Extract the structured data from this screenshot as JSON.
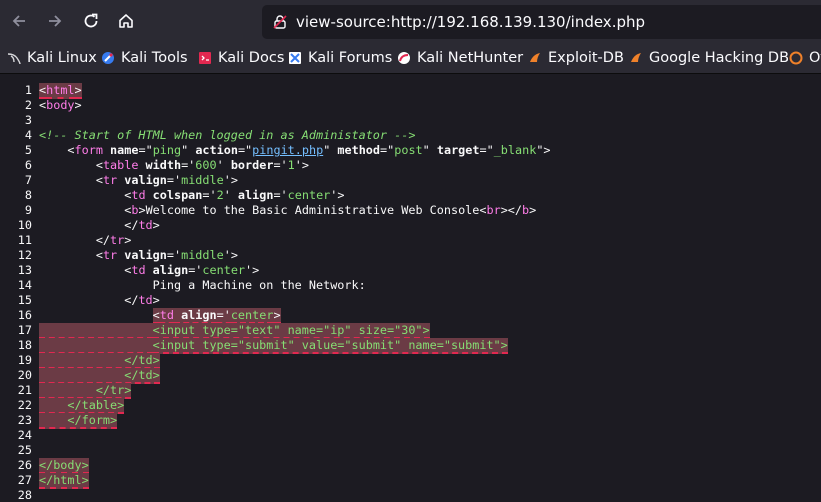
{
  "browser": {
    "url": "view-source:http://192.168.139.130/index.php"
  },
  "bookmarks": [
    {
      "label": "Kali Linux",
      "icon": "kali-dragon-icon"
    },
    {
      "label": "Kali Tools",
      "icon": "kali-tools-icon"
    },
    {
      "label": "Kali Docs",
      "icon": "kali-docs-icon"
    },
    {
      "label": "Kali Forums",
      "icon": "kali-forums-icon"
    },
    {
      "label": "Kali NetHunter",
      "icon": "kali-nethunter-icon"
    },
    {
      "label": "Exploit-DB",
      "icon": "exploit-db-icon"
    },
    {
      "label": "Google Hacking DB",
      "icon": "ghdb-icon"
    },
    {
      "label": "Of",
      "icon": "offsec-icon"
    }
  ],
  "colors": {
    "background": "#1c1b22",
    "toolbar": "#2b2a33",
    "tag_name": "#ff7de9",
    "attr_value": "#86de74",
    "link": "#75bfff",
    "error_highlight": "#6b3b45"
  },
  "source_lines": [
    {
      "n": "1",
      "segs": [
        {
          "t": "<",
          "c": "tag"
        },
        {
          "t": "html",
          "c": "tn"
        },
        {
          "t": ">",
          "c": "tag"
        }
      ],
      "err": true
    },
    {
      "n": "2",
      "segs": [
        {
          "t": "<",
          "c": "tag"
        },
        {
          "t": "body",
          "c": "tn"
        },
        {
          "t": ">",
          "c": "tag"
        }
      ]
    },
    {
      "n": "3",
      "segs": []
    },
    {
      "n": "4",
      "segs": [
        {
          "t": "<!-- Start of HTML when logged in as Administator -->",
          "c": "cm"
        }
      ]
    },
    {
      "n": "5",
      "segs": [
        {
          "t": "    ",
          "c": "tag"
        },
        {
          "t": "<",
          "c": "tag"
        },
        {
          "t": "form",
          "c": "tn"
        },
        {
          "t": " name",
          "c": "an"
        },
        {
          "t": "=\"",
          "c": "tag"
        },
        {
          "t": "ping",
          "c": "av"
        },
        {
          "t": "\"",
          "c": "tag"
        },
        {
          "t": " action",
          "c": "an"
        },
        {
          "t": "=\"",
          "c": "tag"
        },
        {
          "t": "pingit.php",
          "c": "lk"
        },
        {
          "t": "\"",
          "c": "tag"
        },
        {
          "t": " method",
          "c": "an"
        },
        {
          "t": "=\"",
          "c": "tag"
        },
        {
          "t": "post",
          "c": "av"
        },
        {
          "t": "\"",
          "c": "tag"
        },
        {
          "t": " target",
          "c": "an"
        },
        {
          "t": "=\"",
          "c": "tag"
        },
        {
          "t": "_blank",
          "c": "av"
        },
        {
          "t": "\">",
          "c": "tag"
        }
      ]
    },
    {
      "n": "6",
      "segs": [
        {
          "t": "        ",
          "c": "tag"
        },
        {
          "t": "<",
          "c": "tag"
        },
        {
          "t": "table",
          "c": "tn"
        },
        {
          "t": " width",
          "c": "an"
        },
        {
          "t": "='",
          "c": "tag"
        },
        {
          "t": "600",
          "c": "av"
        },
        {
          "t": "'",
          "c": "tag"
        },
        {
          "t": " border",
          "c": "an"
        },
        {
          "t": "='",
          "c": "tag"
        },
        {
          "t": "1",
          "c": "av"
        },
        {
          "t": "'>",
          "c": "tag"
        }
      ]
    },
    {
      "n": "7",
      "segs": [
        {
          "t": "        ",
          "c": "tag"
        },
        {
          "t": "<",
          "c": "tag"
        },
        {
          "t": "tr",
          "c": "tn"
        },
        {
          "t": " valign",
          "c": "an"
        },
        {
          "t": "='",
          "c": "tag"
        },
        {
          "t": "middle",
          "c": "av"
        },
        {
          "t": "'>",
          "c": "tag"
        }
      ]
    },
    {
      "n": "8",
      "segs": [
        {
          "t": "            ",
          "c": "tag"
        },
        {
          "t": "<",
          "c": "tag"
        },
        {
          "t": "td",
          "c": "tn"
        },
        {
          "t": " colspan",
          "c": "an"
        },
        {
          "t": "='",
          "c": "tag"
        },
        {
          "t": "2",
          "c": "av"
        },
        {
          "t": "'",
          "c": "tag"
        },
        {
          "t": " align",
          "c": "an"
        },
        {
          "t": "='",
          "c": "tag"
        },
        {
          "t": "center",
          "c": "av"
        },
        {
          "t": "'>",
          "c": "tag"
        }
      ]
    },
    {
      "n": "9",
      "segs": [
        {
          "t": "            ",
          "c": "tag"
        },
        {
          "t": "<",
          "c": "tag"
        },
        {
          "t": "b",
          "c": "tn"
        },
        {
          "t": ">",
          "c": "tag"
        },
        {
          "t": "Welcome to the Basic Administrative Web Console",
          "c": "tag"
        },
        {
          "t": "<",
          "c": "tag"
        },
        {
          "t": "br",
          "c": "tn"
        },
        {
          "t": "></",
          "c": "tag"
        },
        {
          "t": "b",
          "c": "tn"
        },
        {
          "t": ">",
          "c": "tag"
        }
      ]
    },
    {
      "n": "10",
      "segs": [
        {
          "t": "            ",
          "c": "tag"
        },
        {
          "t": "</",
          "c": "tag"
        },
        {
          "t": "td",
          "c": "tn"
        },
        {
          "t": ">",
          "c": "tag"
        }
      ]
    },
    {
      "n": "11",
      "segs": [
        {
          "t": "        ",
          "c": "tag"
        },
        {
          "t": "</",
          "c": "tag"
        },
        {
          "t": "tr",
          "c": "tn"
        },
        {
          "t": ">",
          "c": "tag"
        }
      ]
    },
    {
      "n": "12",
      "segs": [
        {
          "t": "        ",
          "c": "tag"
        },
        {
          "t": "<",
          "c": "tag"
        },
        {
          "t": "tr",
          "c": "tn"
        },
        {
          "t": " valign",
          "c": "an"
        },
        {
          "t": "='",
          "c": "tag"
        },
        {
          "t": "middle",
          "c": "av"
        },
        {
          "t": "'>",
          "c": "tag"
        }
      ]
    },
    {
      "n": "13",
      "segs": [
        {
          "t": "            ",
          "c": "tag"
        },
        {
          "t": "<",
          "c": "tag"
        },
        {
          "t": "td",
          "c": "tn"
        },
        {
          "t": " align",
          "c": "an"
        },
        {
          "t": "='",
          "c": "tag"
        },
        {
          "t": "center",
          "c": "av"
        },
        {
          "t": "'>",
          "c": "tag"
        }
      ]
    },
    {
      "n": "14",
      "segs": [
        {
          "t": "                Ping a Machine on the Network:",
          "c": "tag"
        }
      ]
    },
    {
      "n": "15",
      "segs": [
        {
          "t": "            ",
          "c": "tag"
        },
        {
          "t": "</",
          "c": "tag"
        },
        {
          "t": "td",
          "c": "tn"
        },
        {
          "t": ">",
          "c": "tag"
        }
      ]
    },
    {
      "n": "16",
      "segs": [
        {
          "t": "                ",
          "c": "tag"
        },
        {
          "t": "<",
          "c": "tag",
          "e": 1
        },
        {
          "t": "td",
          "c": "tn",
          "e": 1
        },
        {
          "t": " align",
          "c": "an",
          "e": 1
        },
        {
          "t": "='",
          "c": "tag",
          "e": 1
        },
        {
          "t": "center",
          "c": "av",
          "e": 1
        },
        {
          "t": ">",
          "c": "tag",
          "e": 1
        }
      ]
    },
    {
      "n": "17",
      "segs": [
        {
          "t": "                ",
          "c": "tag",
          "e": 1
        },
        {
          "t": "<input type=\"text\" name=\"ip\" size=\"30\">",
          "c": "av",
          "e": 1
        }
      ]
    },
    {
      "n": "18",
      "segs": [
        {
          "t": "                ",
          "c": "tag",
          "e": 1
        },
        {
          "t": "<input type=\"submit\" value=\"submit\" name=\"submit\">",
          "c": "av",
          "e": 1
        }
      ]
    },
    {
      "n": "19",
      "segs": [
        {
          "t": "            </td>",
          "c": "av",
          "e": 1
        }
      ]
    },
    {
      "n": "20",
      "segs": [
        {
          "t": "            </td>",
          "c": "av",
          "e": 1
        }
      ]
    },
    {
      "n": "21",
      "segs": [
        {
          "t": "        </tr>",
          "c": "av",
          "e": 1
        }
      ]
    },
    {
      "n": "22",
      "segs": [
        {
          "t": "    </table>",
          "c": "av",
          "e": 1
        }
      ]
    },
    {
      "n": "23",
      "segs": [
        {
          "t": "    </form>",
          "c": "av",
          "e": 1
        }
      ]
    },
    {
      "n": "24",
      "segs": []
    },
    {
      "n": "25",
      "segs": []
    },
    {
      "n": "26",
      "segs": [
        {
          "t": "</body>",
          "c": "av",
          "e": 1
        }
      ]
    },
    {
      "n": "27",
      "segs": [
        {
          "t": "</html>",
          "c": "av",
          "e": 1
        }
      ]
    },
    {
      "n": "28",
      "segs": []
    }
  ]
}
